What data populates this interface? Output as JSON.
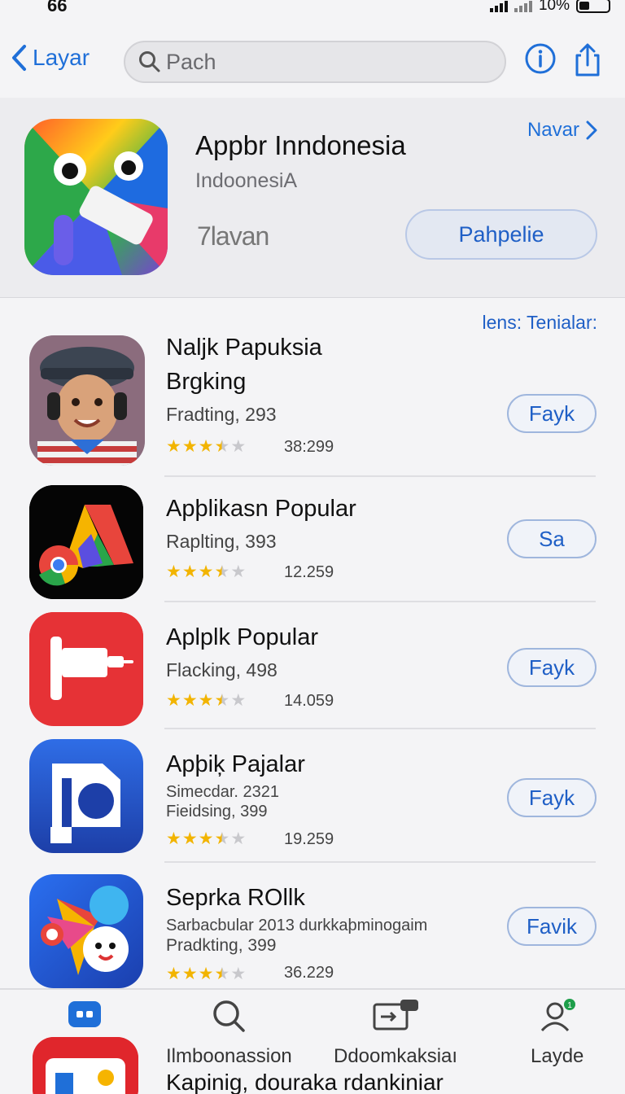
{
  "status": {
    "time": "66",
    "battery": "10%"
  },
  "nav": {
    "back_label": "Layar",
    "search_placeholder": "Pach"
  },
  "featured": {
    "title": "Appbr Inndonesia",
    "subtitle": "IndoonesiA",
    "rating_text": "7lavan",
    "link_label": "Navar",
    "button_label": "Pahpelie"
  },
  "section": {
    "link_label": "lens: Tenialar:"
  },
  "apps": [
    {
      "name_line1": "Naljk Papuksia",
      "name_line2": "Brgking",
      "meta1": "Fradting, 293",
      "meta2": "",
      "stars": 3.5,
      "count": "38:299",
      "button": "Fayk",
      "icon": "boy-headphones-icon"
    },
    {
      "name_line1": "Apþlikasn Popular",
      "name_line2": "",
      "meta1": "Raplting, 393",
      "meta2": "",
      "stars": 3.5,
      "count": "12.259",
      "button": "Sa",
      "icon": "colorful-a-chrome-icon"
    },
    {
      "name_line1": "Aplplk Popular",
      "name_line2": "",
      "meta1": "Flacking, 498",
      "meta2": "",
      "stars": 3.5,
      "count": "14.059",
      "button": "Fayk",
      "icon": "red-plug-icon"
    },
    {
      "name_line1": "Apþiķ Pajalar",
      "name_line2": "",
      "meta1": "Simecdar. 2321",
      "meta2": "Fieidsing, 399",
      "stars": 3.5,
      "count": "19.259",
      "button": "Fayk",
      "icon": "blue-p-icon"
    },
    {
      "name_line1": "Seprka ROllk",
      "name_line2": "",
      "meta1": "Sarbacbular 2013 durkkaþminogaim",
      "meta2": "Pradkting, 399",
      "stars": 3.5,
      "count": "36.229",
      "button": "Favik",
      "icon": "colorful-face-icon"
    }
  ],
  "tabs": [
    {
      "label": "",
      "icon": "today-icon",
      "active": true
    },
    {
      "label": "Ilmboonassion",
      "icon": "search-icon",
      "active": false
    },
    {
      "label": "Ddoomkaksiaı",
      "icon": "arcade-icon",
      "active": false
    },
    {
      "label": "Layde",
      "icon": "account-icon",
      "active": false
    }
  ],
  "bottom_peek": {
    "text": "Kapinig, douraka rdankiniar"
  },
  "colors": {
    "accent": "#1f6fd8",
    "star": "#f2b400",
    "background": "#f4f4f6"
  }
}
